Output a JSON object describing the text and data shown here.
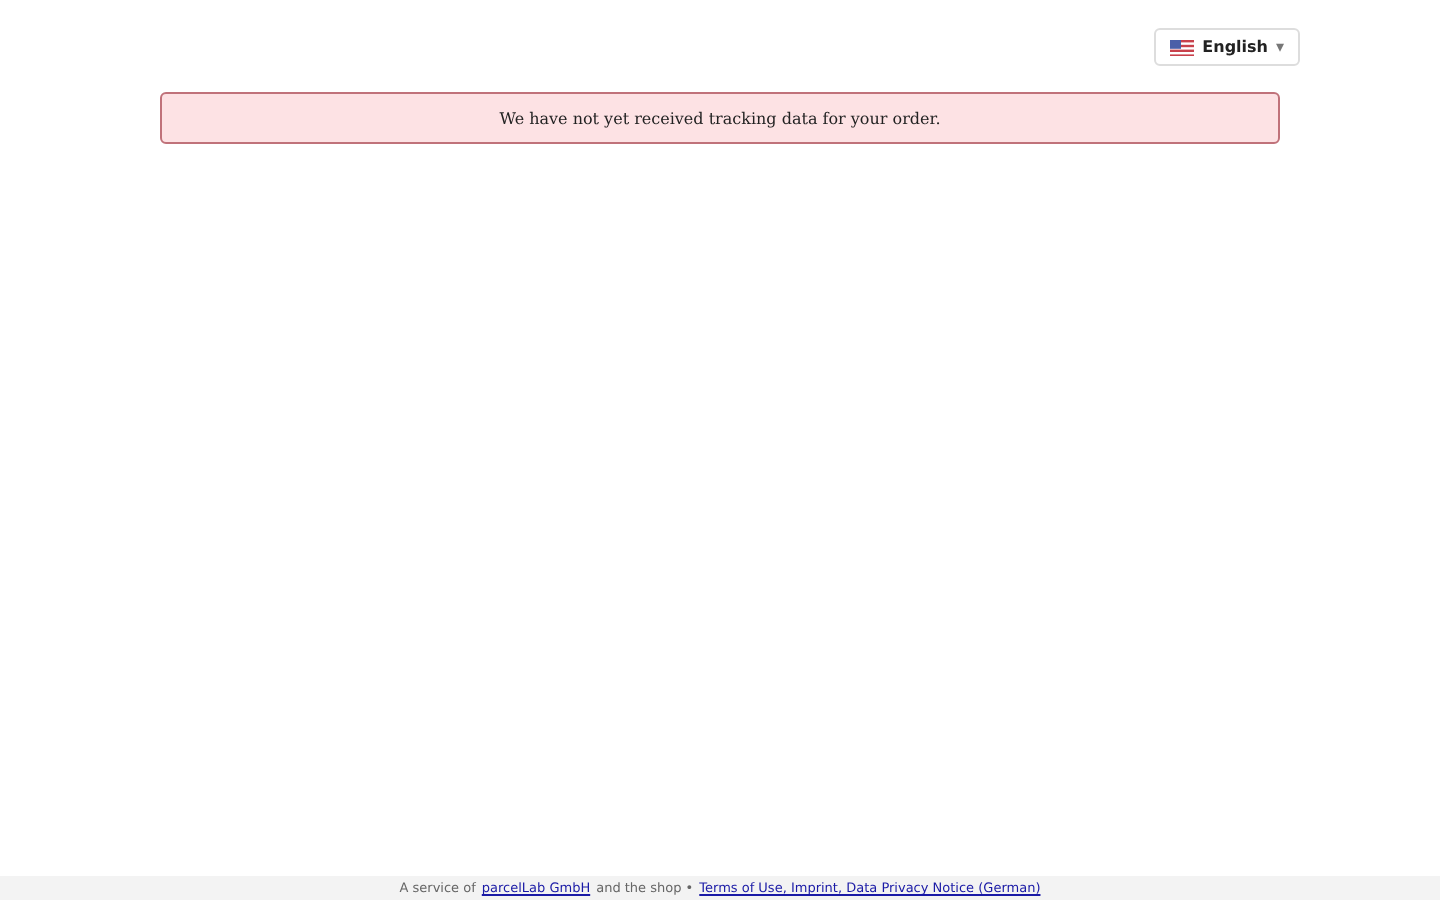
{
  "language_selector": {
    "label": "English",
    "caret": "▾"
  },
  "alert": {
    "message": "We have not yet received tracking data for your order."
  },
  "footer": {
    "prefix": "A service of",
    "company_link": "parcelLab GmbH",
    "middle": "and the shop •",
    "legal_link": "Terms of Use, Imprint, Data Privacy Notice (German)"
  }
}
